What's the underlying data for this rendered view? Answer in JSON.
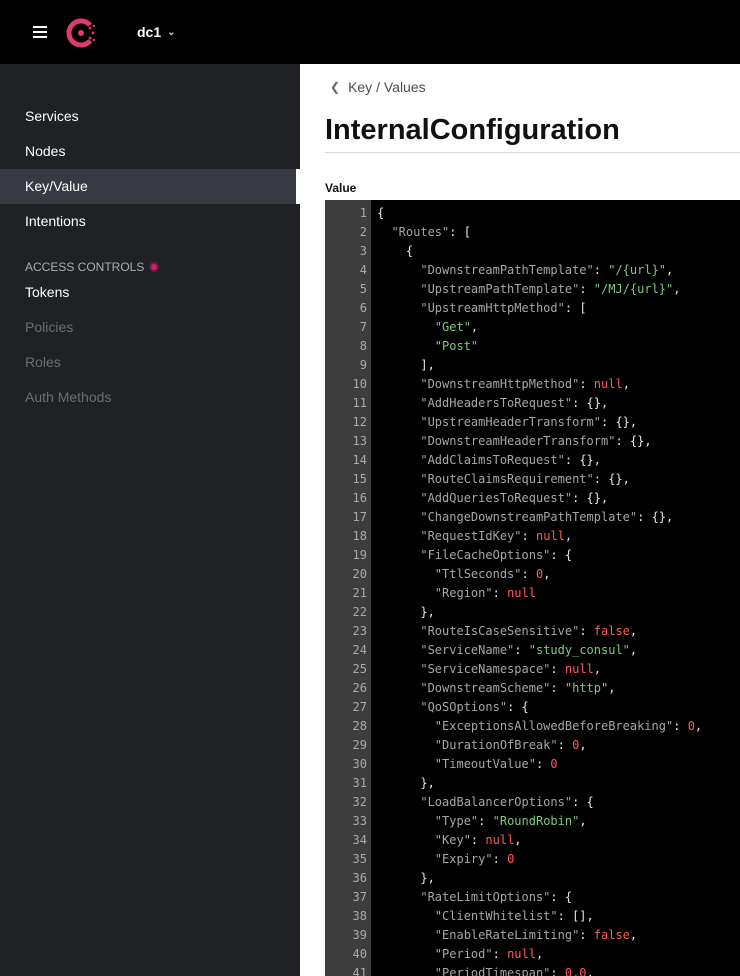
{
  "header": {
    "datacenter": "dc1",
    "accent_color": "#e03875"
  },
  "sidebar": {
    "items": [
      {
        "label": "Services"
      },
      {
        "label": "Nodes"
      },
      {
        "label": "Key/Value"
      },
      {
        "label": "Intentions"
      }
    ],
    "section": "ACCESS CONTROLS",
    "acl_items": [
      {
        "label": "Tokens"
      },
      {
        "label": "Policies"
      },
      {
        "label": "Roles"
      },
      {
        "label": "Auth Methods"
      }
    ]
  },
  "main": {
    "breadcrumb": "Key / Values",
    "title": "InternalConfiguration",
    "value_label": "Value"
  },
  "editor": {
    "lines": [
      "{",
      "  \"Routes\": [",
      "    {",
      "      \"DownstreamPathTemplate\": \"/{url}\",",
      "      \"UpstreamPathTemplate\": \"/MJ/{url}\",",
      "      \"UpstreamHttpMethod\": [",
      "        \"Get\",",
      "        \"Post\"",
      "      ],",
      "      \"DownstreamHttpMethod\": null,",
      "      \"AddHeadersToRequest\": {},",
      "      \"UpstreamHeaderTransform\": {},",
      "      \"DownstreamHeaderTransform\": {},",
      "      \"AddClaimsToRequest\": {},",
      "      \"RouteClaimsRequirement\": {},",
      "      \"AddQueriesToRequest\": {},",
      "      \"ChangeDownstreamPathTemplate\": {},",
      "      \"RequestIdKey\": null,",
      "      \"FileCacheOptions\": {",
      "        \"TtlSeconds\": 0,",
      "        \"Region\": null",
      "      },",
      "      \"RouteIsCaseSensitive\": false,",
      "      \"ServiceName\": \"study_consul\",",
      "      \"ServiceNamespace\": null,",
      "      \"DownstreamScheme\": \"http\",",
      "      \"QoSOptions\": {",
      "        \"ExceptionsAllowedBeforeBreaking\": 0,",
      "        \"DurationOfBreak\": 0,",
      "        \"TimeoutValue\": 0",
      "      },",
      "      \"LoadBalancerOptions\": {",
      "        \"Type\": \"RoundRobin\",",
      "        \"Key\": null,",
      "        \"Expiry\": 0",
      "      },",
      "      \"RateLimitOptions\": {",
      "        \"ClientWhitelist\": [],",
      "        \"EnableRateLimiting\": false,",
      "        \"Period\": null,",
      "        \"PeriodTimespan\": 0.0,"
    ],
    "colors": {
      "key": "#a6a6a6",
      "string": "#7ec97e",
      "literal": "#ff5b5b",
      "punct": "#e6e6e6"
    }
  }
}
